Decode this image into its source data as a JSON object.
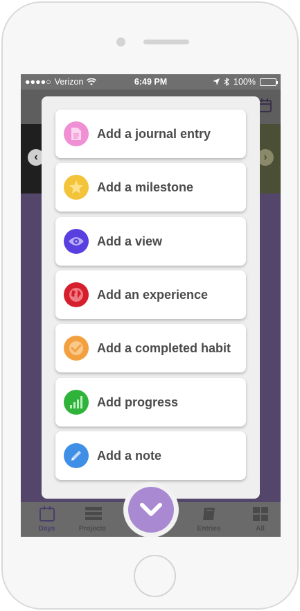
{
  "status_bar": {
    "carrier": "Verizon",
    "time": "6:49 PM",
    "battery": "100%"
  },
  "menu": {
    "items": [
      {
        "label": "Add a journal entry",
        "icon": "document-icon",
        "color": "#f08fd3"
      },
      {
        "label": "Add a milestone",
        "icon": "star-icon",
        "color": "#f3c33a"
      },
      {
        "label": "Add a view",
        "icon": "eye-icon",
        "color": "#5a3fe0"
      },
      {
        "label": "Add an experience",
        "icon": "globe-icon",
        "color": "#d61f2d"
      },
      {
        "label": "Add a completed habit",
        "icon": "checkmark-icon",
        "color": "#f2a040"
      },
      {
        "label": "Add progress",
        "icon": "signal-bars-icon",
        "color": "#2fb33b"
      },
      {
        "label": "Add a note",
        "icon": "pencil-icon",
        "color": "#3f8fe6"
      }
    ]
  },
  "tabbar": {
    "tabs": [
      {
        "label": "Days",
        "icon": "calendar-icon"
      },
      {
        "label": "Projects",
        "icon": "server-stack-icon"
      },
      {
        "label": "Entries",
        "icon": "book-icon"
      },
      {
        "label": "All",
        "icon": "grid-icon"
      }
    ]
  },
  "colors": {
    "accent": "#a98ad2",
    "background": "#54466b"
  }
}
